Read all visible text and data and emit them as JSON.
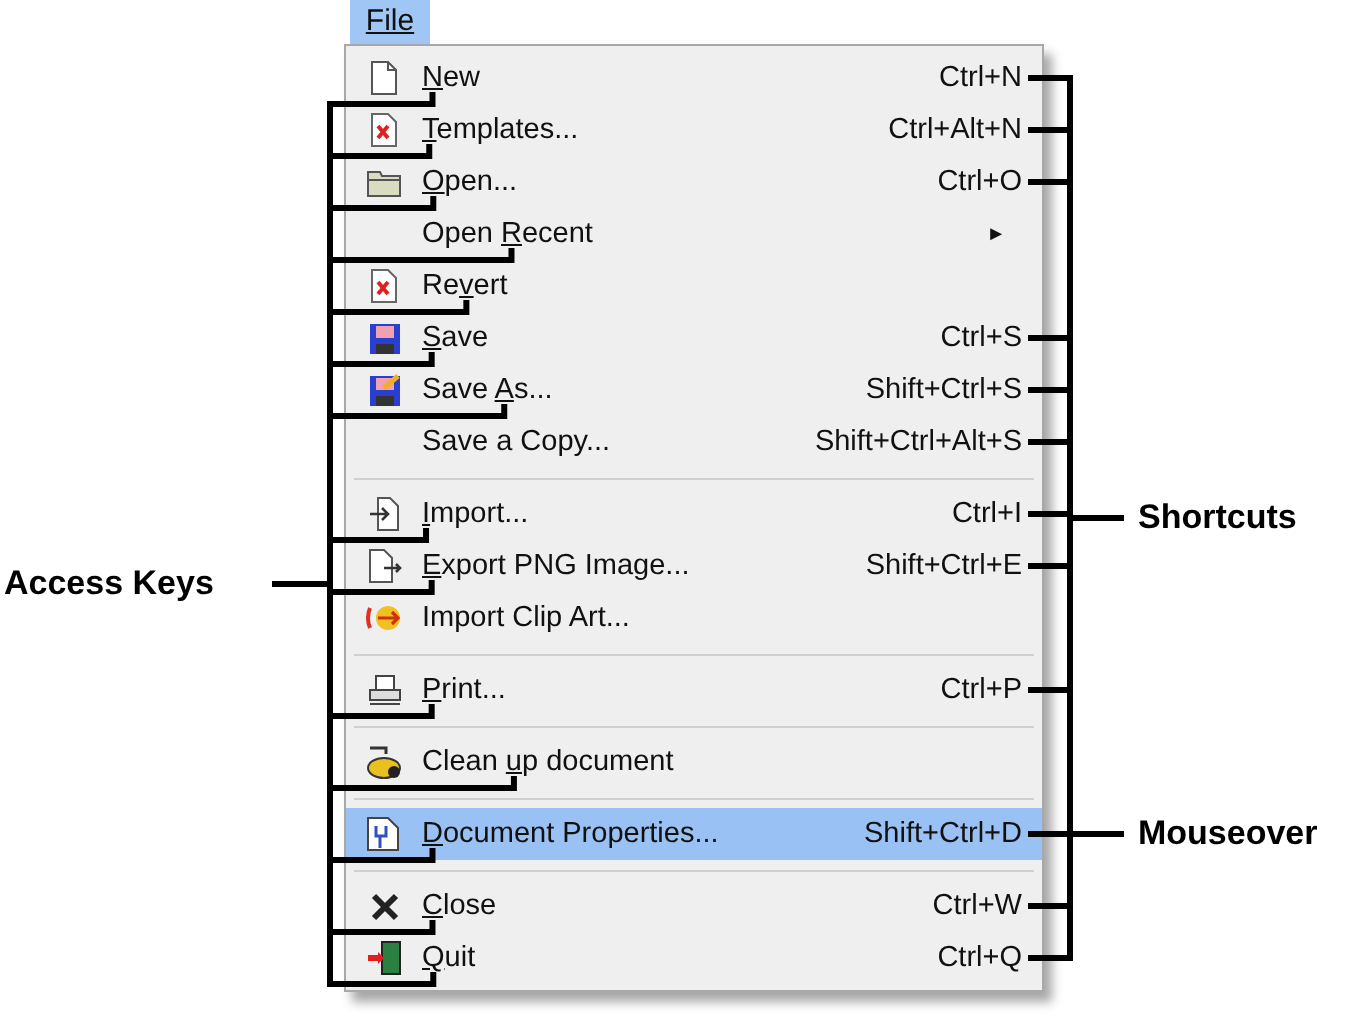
{
  "menu": {
    "title": "File",
    "open": true,
    "items": [
      {
        "kind": "item",
        "key": "N",
        "post": "ew",
        "shortcut": "Ctrl+N",
        "selected": false
      },
      {
        "kind": "item",
        "key": "T",
        "post": "emplates...",
        "shortcut": "Ctrl+Alt+N",
        "selected": false
      },
      {
        "kind": "item",
        "key": "O",
        "post": "pen...",
        "shortcut": "Ctrl+O",
        "selected": false
      },
      {
        "kind": "item",
        "pre": "Open ",
        "key": "R",
        "post": "ecent",
        "submenu": "►",
        "selected": false
      },
      {
        "kind": "item",
        "pre": "Re",
        "key": "v",
        "post": "ert",
        "selected": false
      },
      {
        "kind": "item",
        "key": "S",
        "post": "ave",
        "shortcut": "Ctrl+S",
        "selected": false
      },
      {
        "kind": "item",
        "pre": "Save ",
        "key": "A",
        "post": "s...",
        "shortcut": "Shift+Ctrl+S",
        "selected": false
      },
      {
        "kind": "item",
        "pre": "Save a Copy...",
        "shortcut": "Shift+Ctrl+Alt+S",
        "selected": false
      },
      {
        "kind": "separator"
      },
      {
        "kind": "item",
        "key": "I",
        "post": "mport...",
        "shortcut": "Ctrl+I",
        "selected": false
      },
      {
        "kind": "item",
        "key": "E",
        "post": "xport PNG Image...",
        "shortcut": "Shift+Ctrl+E",
        "selected": false
      },
      {
        "kind": "item",
        "pre": "Import Clip Art...",
        "selected": false
      },
      {
        "kind": "separator"
      },
      {
        "kind": "item",
        "key": "P",
        "post": "rint...",
        "shortcut": "Ctrl+P",
        "selected": false
      },
      {
        "kind": "separator"
      },
      {
        "kind": "item",
        "pre": "Clean ",
        "key": "u",
        "post": "p document",
        "selected": false
      },
      {
        "kind": "separator"
      },
      {
        "kind": "item",
        "key": "D",
        "post": "ocument Properties...",
        "shortcut": "Shift+Ctrl+D",
        "selected": true
      },
      {
        "kind": "separator"
      },
      {
        "kind": "item",
        "key": "C",
        "post": "lose",
        "shortcut": "Ctrl+W",
        "selected": false
      },
      {
        "kind": "item",
        "key": "Q",
        "post": "uit",
        "shortcut": "Ctrl+Q",
        "selected": false
      }
    ]
  },
  "annotations": [
    {
      "kind": "access_keys",
      "text": "Access Keys"
    },
    {
      "kind": "shortcuts",
      "text": "Shortcuts"
    },
    {
      "kind": "mouseover",
      "text": "Mouseover"
    }
  ]
}
